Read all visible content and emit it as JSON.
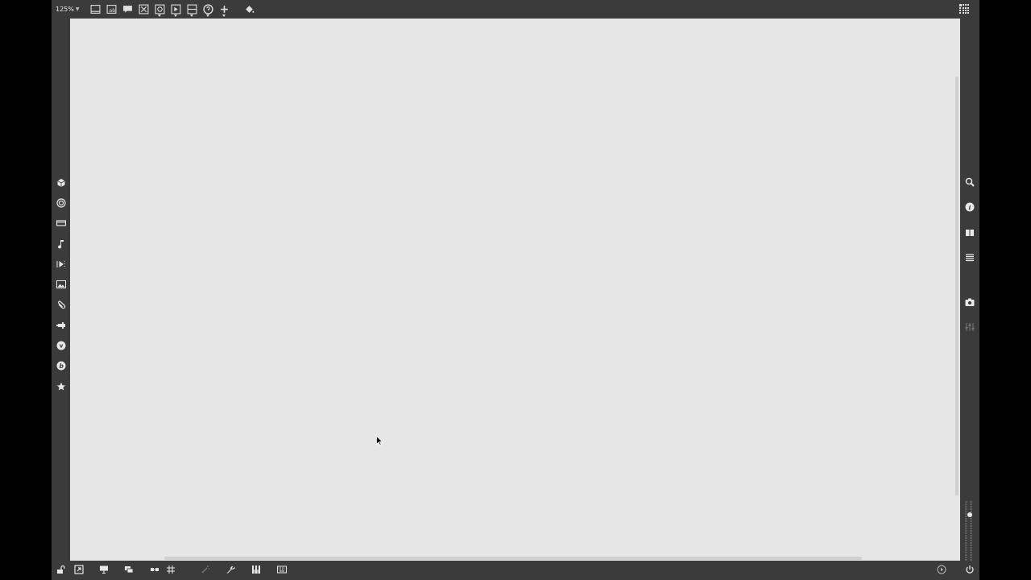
{
  "toolbar": {
    "zoom_label": "125%",
    "icons": [
      "window-icon",
      "edit-window-icon",
      "comment-icon",
      "close-box-icon",
      "radio-icon",
      "play-box-icon",
      "split-icon",
      "help-icon",
      "plus-icon",
      "paint-bucket-icon"
    ]
  },
  "left_sidebar": {
    "items": [
      "cube-icon",
      "target-icon",
      "screen-icon",
      "music-note-icon",
      "sequencer-icon",
      "image-icon",
      "paperclip-icon",
      "plugin-icon",
      "vimeo-icon",
      "pitchfork-icon",
      "star-icon"
    ]
  },
  "right_sidebar": {
    "items": [
      "search-icon",
      "info-icon",
      "book-icon",
      "list-icon",
      "camera-icon",
      "mixer-icon"
    ]
  },
  "bottom_bar": {
    "items": [
      "lock-icon",
      "open-external-icon",
      "presentation-icon",
      "layers-icon",
      "link-icon",
      "grid-icon",
      "magic-icon",
      "wrench-icon",
      "piano-icon",
      "keyboard-icon",
      "play-circle-icon",
      "power-icon"
    ]
  },
  "meter": {
    "level": 0.8
  },
  "colors": {
    "app_bg": "#3b3b3b",
    "canvas_bg": "#e6e6e6",
    "icon": "#e8e8e8"
  }
}
